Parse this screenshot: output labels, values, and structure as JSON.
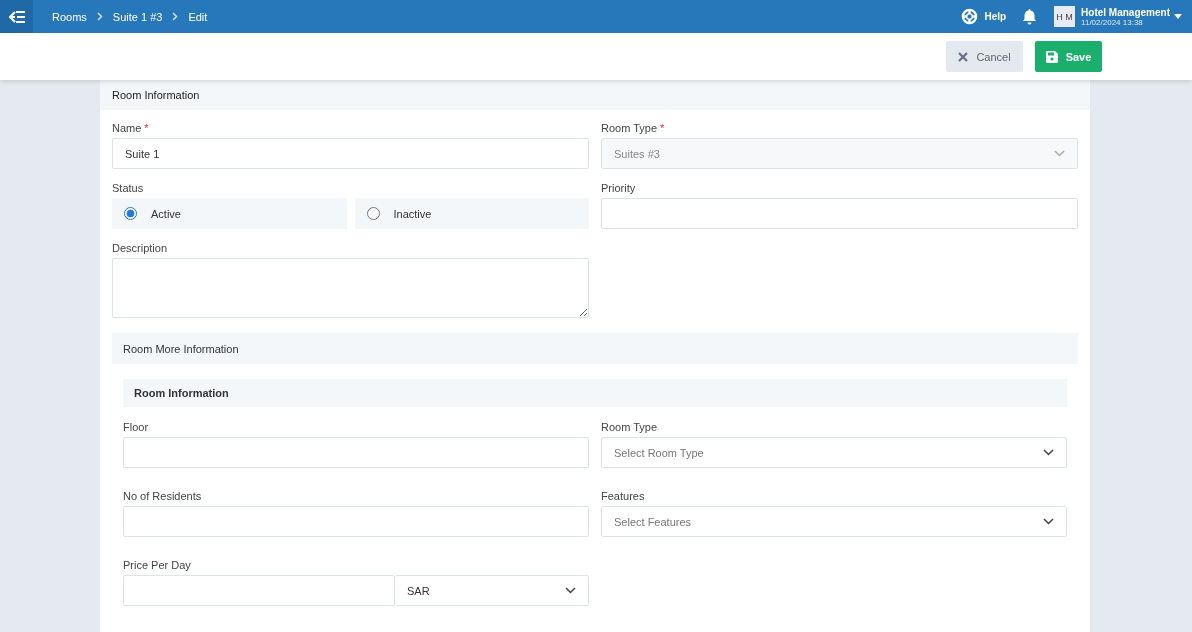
{
  "topbar": {
    "breadcrumb": [
      "Rooms",
      "Suite 1 #3",
      "Edit"
    ],
    "help": "Help",
    "user": {
      "initials": "H M",
      "name": "Hotel Management",
      "datetime": "11/02/2024 13:38"
    }
  },
  "actions": [
    {
      "label": "Cancel",
      "kind": "cancel"
    },
    {
      "label": "Save",
      "kind": "save"
    }
  ],
  "section": {
    "title": "Room Information",
    "fields": [
      {
        "kind": "text",
        "label": "Name",
        "required_mark": "*",
        "value": "Suite 1"
      },
      {
        "kind": "select",
        "label": "Room Type",
        "required_mark": "*",
        "disabled": true,
        "value": "Suites #3"
      },
      {
        "kind": "radio",
        "label": "Status",
        "options": [
          {
            "label": "Active",
            "selected": true
          },
          {
            "label": "Inactive",
            "selected": false
          }
        ]
      },
      {
        "kind": "text",
        "label": "Priority"
      },
      {
        "kind": "textarea",
        "label": "Description"
      }
    ]
  },
  "more": {
    "title": "Room More Information",
    "subtitle": "Room Information",
    "fields": [
      {
        "kind": "text",
        "label": "Floor"
      },
      {
        "kind": "select",
        "label": "Room Type",
        "disabled": false,
        "placeholder": "Select Room Type"
      },
      {
        "kind": "text",
        "label": "No of Residents"
      },
      {
        "kind": "select",
        "label": "Features",
        "disabled": false,
        "placeholder": "Select Features"
      },
      {
        "kind": "currency",
        "label": "Price Per Day",
        "currency": "SAR"
      }
    ]
  }
}
